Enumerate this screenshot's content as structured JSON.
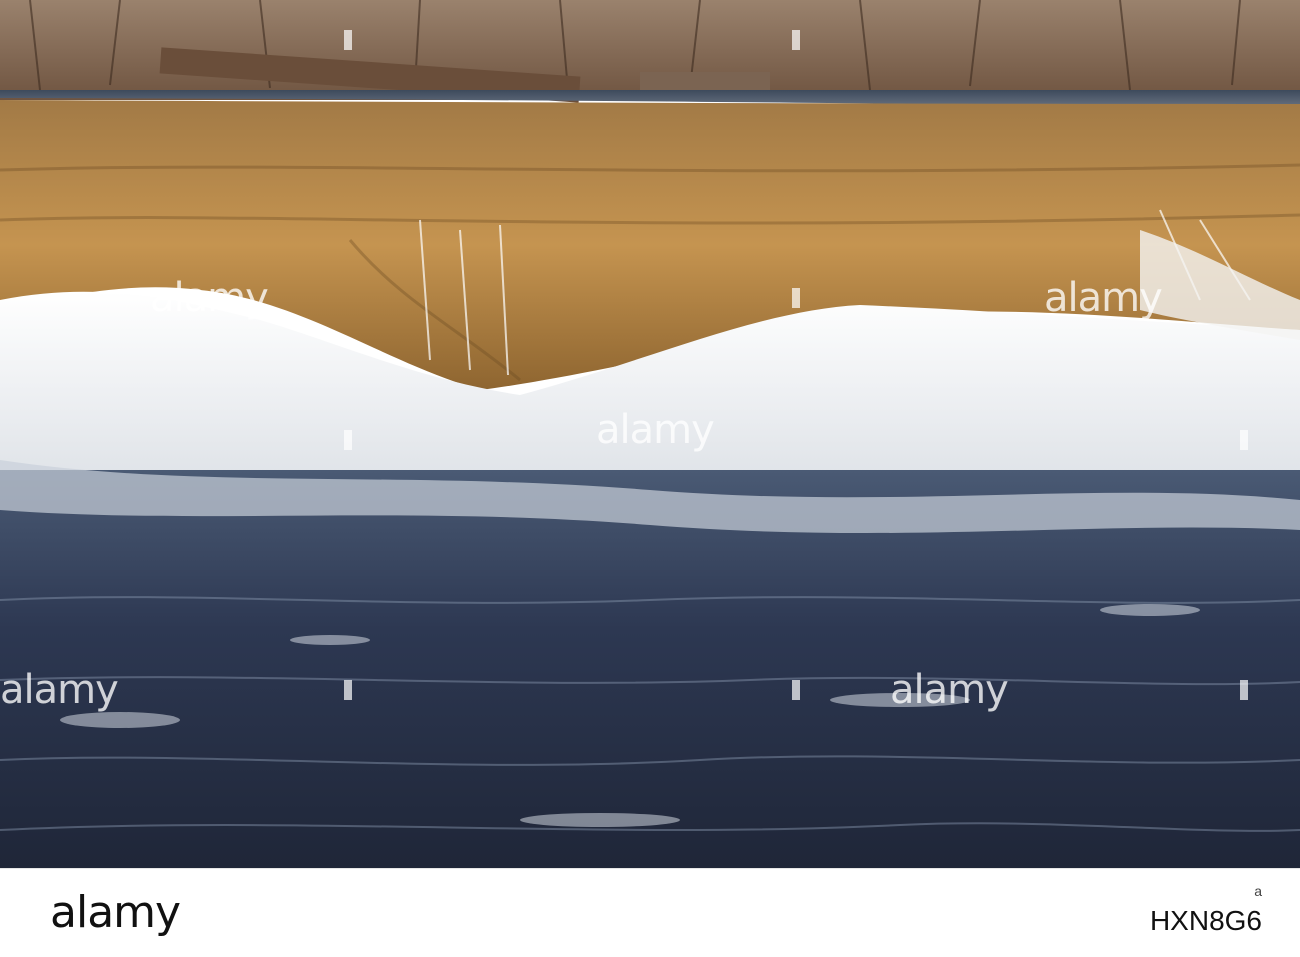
{
  "watermark": {
    "text": "alamy"
  },
  "footer": {
    "brand": "alamy",
    "image_code": "HXN8G6",
    "image_code_label": "a"
  },
  "colors": {
    "sky_trees": "#8a6f58",
    "dam_lip": "#4a5a6e",
    "rock_face": "#b98a45",
    "foam": "#f2f2ee",
    "water": "#2b3448"
  }
}
